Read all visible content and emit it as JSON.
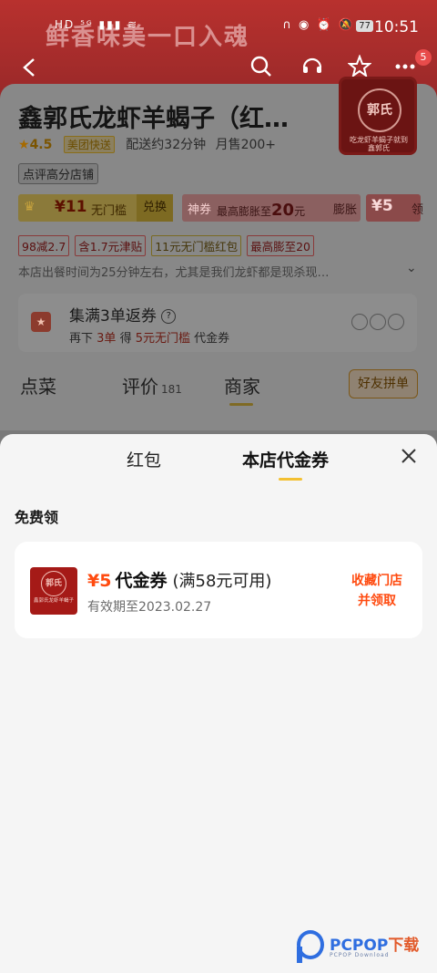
{
  "status_bar": {
    "left_icons": "HD ⁵ᴳ ▮▮▮ ≋",
    "right_icons": "∩ ◉ ⏰ 🔕",
    "battery": "77",
    "time": "10:51"
  },
  "hero": {
    "slogan": "鲜香味美一口入魂"
  },
  "nav": {
    "back_icon": "back-arrow-icon",
    "badge": "5"
  },
  "store": {
    "name": "鑫郭氏龙虾羊蝎子（红…",
    "logo_mark": "郭氏",
    "logo_caption": "吃龙虾羊蝎子就到 鑫郭氏",
    "rating": "4.5",
    "delivery_tag": "美团快送",
    "delivery_time": "配送约32分钟",
    "monthly_sales": "月售200+",
    "badge": "点评高分店铺"
  },
  "coupon_strip": {
    "member": {
      "amount": "¥11",
      "label": "无门槛",
      "action": "兑换"
    },
    "shen": {
      "tag": "神券",
      "text_prefix": "最高膨胀至",
      "amount": "20",
      "unit": "元",
      "action": "膨胀"
    },
    "small": {
      "amount": "¥5",
      "tail": "领"
    }
  },
  "promos": [
    "98减2.7",
    "含1.7元津贴",
    "11元无门槛红包",
    "最高膨至20"
  ],
  "notice": "本店出餐时间为25分钟左右，尤其是我们龙虾都是现杀现…",
  "stamp": {
    "title": "集满3单返券",
    "sub_prefix": "再下",
    "sub_count": "3单",
    "sub_mid": "得",
    "sub_reward": "5元无门槛",
    "sub_suffix": "代金券"
  },
  "tabs": [
    {
      "label": "点菜",
      "count": ""
    },
    {
      "label": "评价",
      "count": "181"
    },
    {
      "label": "商家",
      "count": ""
    }
  ],
  "group_button": "好友拼单",
  "sheet": {
    "tabs": [
      "红包",
      "本店代金券"
    ],
    "active_tab": 1,
    "section_title": "免费领",
    "voucher": {
      "amount": "¥5",
      "name": "代金券",
      "condition": "(满58元可用)",
      "expiry": "有效期至2023.02.27",
      "action_line1": "收藏门店",
      "action_line2": "并领取",
      "logo_mark": "郭氏",
      "logo_caption": "鑫郭氏龙虾羊蝎子"
    }
  },
  "watermark": {
    "brand": "PCPOP",
    "brand_cn": "下载",
    "sub": "PCPOP Download"
  },
  "colors": {
    "accent_orange": "#ff4b10",
    "sheet_underline": "#f3c032",
    "hero_red": "#b8312e"
  }
}
